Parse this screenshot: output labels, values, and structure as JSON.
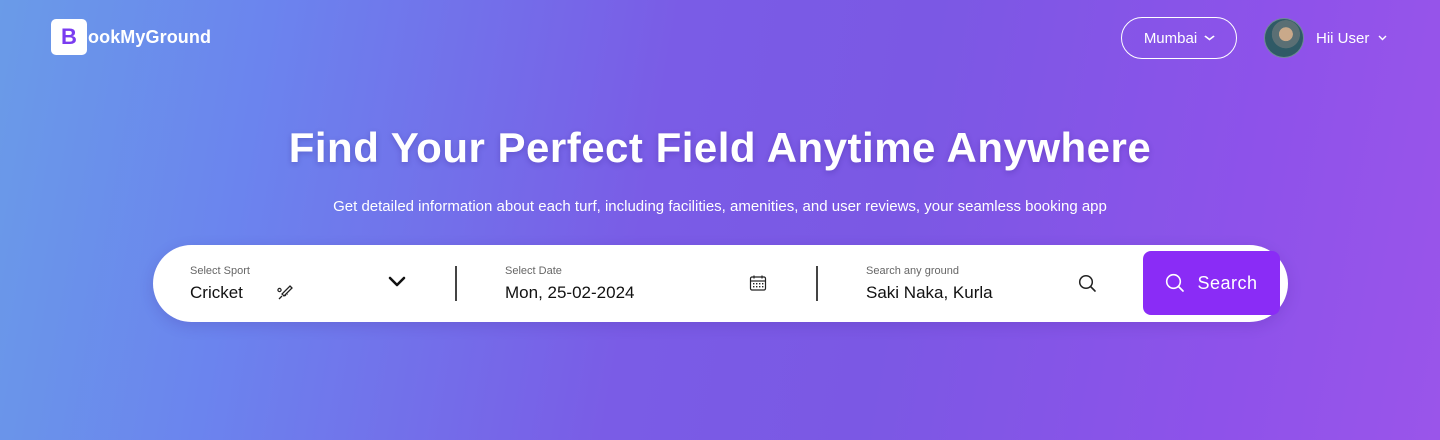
{
  "brand": {
    "badge": "B",
    "rest": "ookMyGround"
  },
  "header": {
    "city": "Mumbai",
    "user_greeting": "Hii User"
  },
  "hero": {
    "title": "Find Your Perfect Field Anytime Anywhere",
    "subtitle": "Get detailed information about each turf, including facilities, amenities, and user reviews, your seamless booking app"
  },
  "search": {
    "sport_label": "Select Sport",
    "sport_value": "Cricket",
    "date_label": "Select Date",
    "date_value": "Mon, 25-02-2024",
    "ground_label": "Search any ground",
    "ground_value": "Saki Naka, Kurla",
    "button_label": "Search"
  },
  "colors": {
    "accent": "#8a2cf6",
    "brand": "#7a3cf0"
  },
  "icons": [
    "chevron-down-icon",
    "cricket-bat-icon",
    "calendar-icon",
    "search-icon"
  ]
}
